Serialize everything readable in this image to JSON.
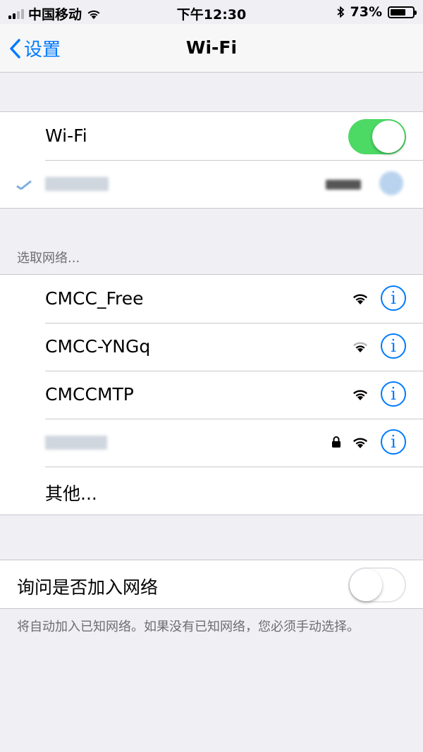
{
  "status_bar": {
    "carrier": "中国移动",
    "time": "下午12:30",
    "battery_percent": "73%",
    "battery_level": 0.73
  },
  "nav": {
    "back_label": "设置",
    "title": "Wi-Fi"
  },
  "wifi_toggle": {
    "label": "Wi-Fi",
    "on": true
  },
  "choose_network_header": "选取网络...",
  "networks": [
    {
      "name": "CMCC_Free",
      "secured": false,
      "signal": 3
    },
    {
      "name": "CMCC-YNGq",
      "secured": false,
      "signal": 2
    },
    {
      "name": "CMCCMTP",
      "secured": false,
      "signal": 3
    },
    {
      "name": "",
      "secured": true,
      "signal": 3
    }
  ],
  "other_label": "其他...",
  "ask_to_join": {
    "label": "询问是否加入网络",
    "on": false,
    "footer": "将自动加入已知网络。如果没有已知网络，您必须手动选择。"
  },
  "colors": {
    "accent": "#007aff",
    "toggle_on": "#4cd964",
    "background": "#efeff4"
  }
}
